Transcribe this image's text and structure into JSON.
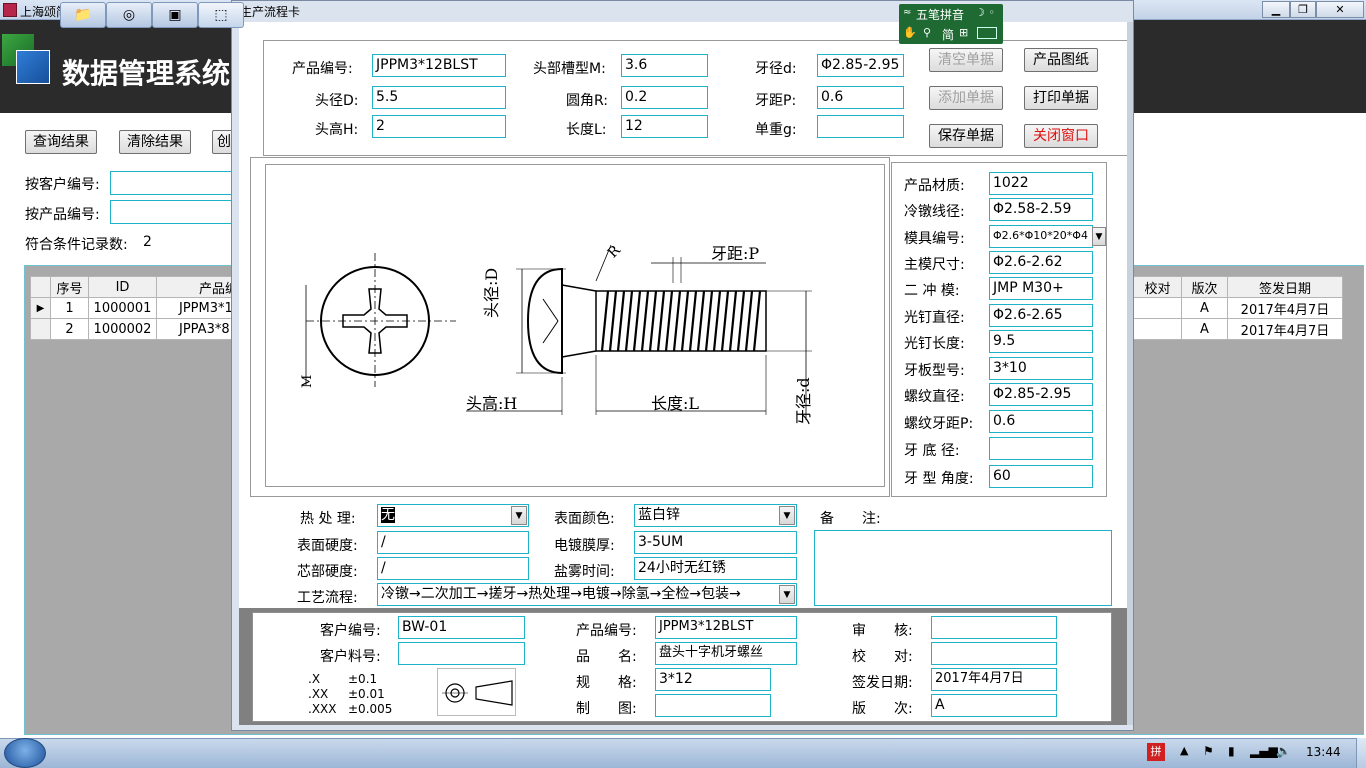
{
  "bg": {
    "title": "上海颂简实业有限公司数据管理系统 - [",
    "header_title": "数据管理系统",
    "buttons": {
      "query": "查询结果",
      "clear": "清除结果",
      "create": "创"
    },
    "filters": {
      "by_customer": "按客户编号:",
      "by_product": "按产品编号:",
      "record_count_label": "符合条件记录数:",
      "record_count": "2"
    },
    "grid": {
      "headers": [
        "序号",
        "ID",
        "产品编",
        "校对",
        "版次",
        "签发日期"
      ],
      "rows": [
        {
          "no": "1",
          "id": "1000001",
          "product": "JPPM3*1",
          "version": "A",
          "date": "2017年4月7日"
        },
        {
          "no": "2",
          "id": "1000002",
          "product": "JPPA3*8",
          "version": "A",
          "date": "2017年4月7日"
        }
      ]
    }
  },
  "dialog": {
    "title": "生产流程卡",
    "top_fields": {
      "product_no": {
        "label": "产品编号:",
        "value": "JPPM3*12BLST"
      },
      "head_dia": {
        "label": "头径D:",
        "value": "5.5"
      },
      "head_height": {
        "label": "头高H:",
        "value": "2"
      },
      "slot": {
        "label": "头部槽型M:",
        "value": "3.6"
      },
      "fillet": {
        "label": "圆角R:",
        "value": "0.2"
      },
      "length": {
        "label": "长度L:",
        "value": "12"
      },
      "thread_dia": {
        "label": "牙径d:",
        "value": "Φ2.85-2.95"
      },
      "pitch": {
        "label": "牙距P:",
        "value": "0.6"
      },
      "weight": {
        "label": "单重g:",
        "value": ""
      }
    },
    "buttons": {
      "clear": "清空单据",
      "add": "添加单据",
      "save": "保存单据",
      "drawing": "产品图纸",
      "print": "打印单据",
      "close": "关闭窗口"
    },
    "drawing_labels": {
      "pitch": "牙距:P",
      "head_dia": "头径:D",
      "head_height": "头高:H",
      "length": "长度:L",
      "thread_dia": "牙径:d",
      "r": "R",
      "m": "M"
    },
    "right_fields": [
      {
        "label": "产品材质:",
        "value": "1022"
      },
      {
        "label": "冷镦线径:",
        "value": "Φ2.58-2.59"
      },
      {
        "label": "模具编号:",
        "value": "Φ2.6*Φ10*20*Φ4"
      },
      {
        "label": "主模尺寸:",
        "value": "Φ2.6-2.62"
      },
      {
        "label": "二 冲 模:",
        "value": "JMP M30+"
      },
      {
        "label": "光钉直径:",
        "value": "Φ2.6-2.65"
      },
      {
        "label": "光钉长度:",
        "value": "9.5"
      },
      {
        "label": "牙板型号:",
        "value": "3*10"
      },
      {
        "label": "螺纹直径:",
        "value": "Φ2.85-2.95"
      },
      {
        "label": "螺纹牙距P:",
        "value": "0.6"
      },
      {
        "label": "牙 底 径:",
        "value": ""
      },
      {
        "label": "牙 型 角度:",
        "value": "60"
      }
    ],
    "process": {
      "heat_label": "热 处 理:",
      "heat_value": "无",
      "surface_hard_label": "表面硬度:",
      "surface_hard_value": "/",
      "core_hard_label": "芯部硬度:",
      "core_hard_value": "/",
      "flow_label": "工艺流程:",
      "flow_value": "冷镦→二次加工→搓牙→热处理→电镀→除氢→全检→包装→",
      "color_label": "表面颜色:",
      "color_value": "蓝白锌",
      "plating_label": "电镀膜厚:",
      "plating_value": "3-5UM",
      "salt_label": "盐雾时间:",
      "salt_value": "24小时无红锈",
      "remark_label": "备　　注:"
    },
    "footer": {
      "customer_no_label": "客户编号:",
      "customer_no": "BW-01",
      "customer_part_label": "客户料号:",
      "customer_part": "",
      "tol": [
        {
          "k": ".X",
          "v": "±0.1"
        },
        {
          "k": ".XX",
          "v": "±0.01"
        },
        {
          "k": ".XXX",
          "v": "±0.005"
        }
      ],
      "product_no_label": "产品编号:",
      "product_no": "JPPM3*12BLST",
      "name_label": "品　　名:",
      "name": "盘头十字机牙螺丝",
      "spec_label": "规　　格:",
      "spec": "3*12",
      "drafter_label": "制　　图:",
      "drafter": "",
      "review_label": "审　　核:",
      "review": "",
      "check_label": "校　　对:",
      "check": "",
      "issue_label": "签发日期:",
      "issue": "2017年4月7日",
      "version_label": "版　　次:",
      "version": "A"
    }
  },
  "ime": {
    "mode": "五笔拼音",
    "simp": "简"
  },
  "taskbar": {
    "time": "13:44"
  }
}
